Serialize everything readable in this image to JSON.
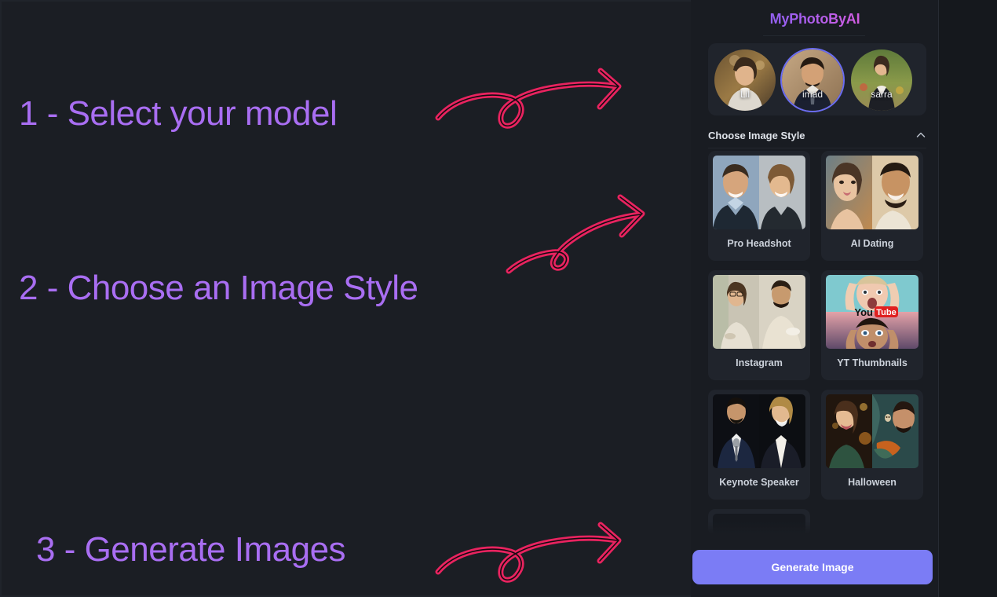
{
  "app": {
    "brand": "MyPhotoByAI",
    "accent_purple": "#7b7cf5",
    "accent_pink": "#e8235f",
    "annotation_color": "#a96ef2",
    "panel_bg": "#191c22",
    "card_bg": "#20242c"
  },
  "annotations": [
    {
      "text": "1 - Select your model",
      "arrow": "curly-arrow-right"
    },
    {
      "text": "2 - Choose an Image Style",
      "arrow": "curly-arrow-up-right"
    },
    {
      "text": "3 - Generate Images",
      "arrow": "curly-arrow-right"
    }
  ],
  "model_selector": {
    "models": [
      {
        "name": "Lil",
        "selected": false
      },
      {
        "name": "imad",
        "selected": true
      },
      {
        "name": "sarra",
        "selected": false
      }
    ]
  },
  "style_section": {
    "title": "Choose Image Style",
    "collapse_icon": "chevron-up-icon",
    "expanded": true,
    "styles": [
      {
        "label": "Pro Headshot"
      },
      {
        "label": "AI Dating"
      },
      {
        "label": "Instagram"
      },
      {
        "label": "YT Thumbnails"
      },
      {
        "label": "Keynote Speaker"
      },
      {
        "label": "Halloween"
      }
    ]
  },
  "footer": {
    "generate_label": "Generate Image"
  }
}
